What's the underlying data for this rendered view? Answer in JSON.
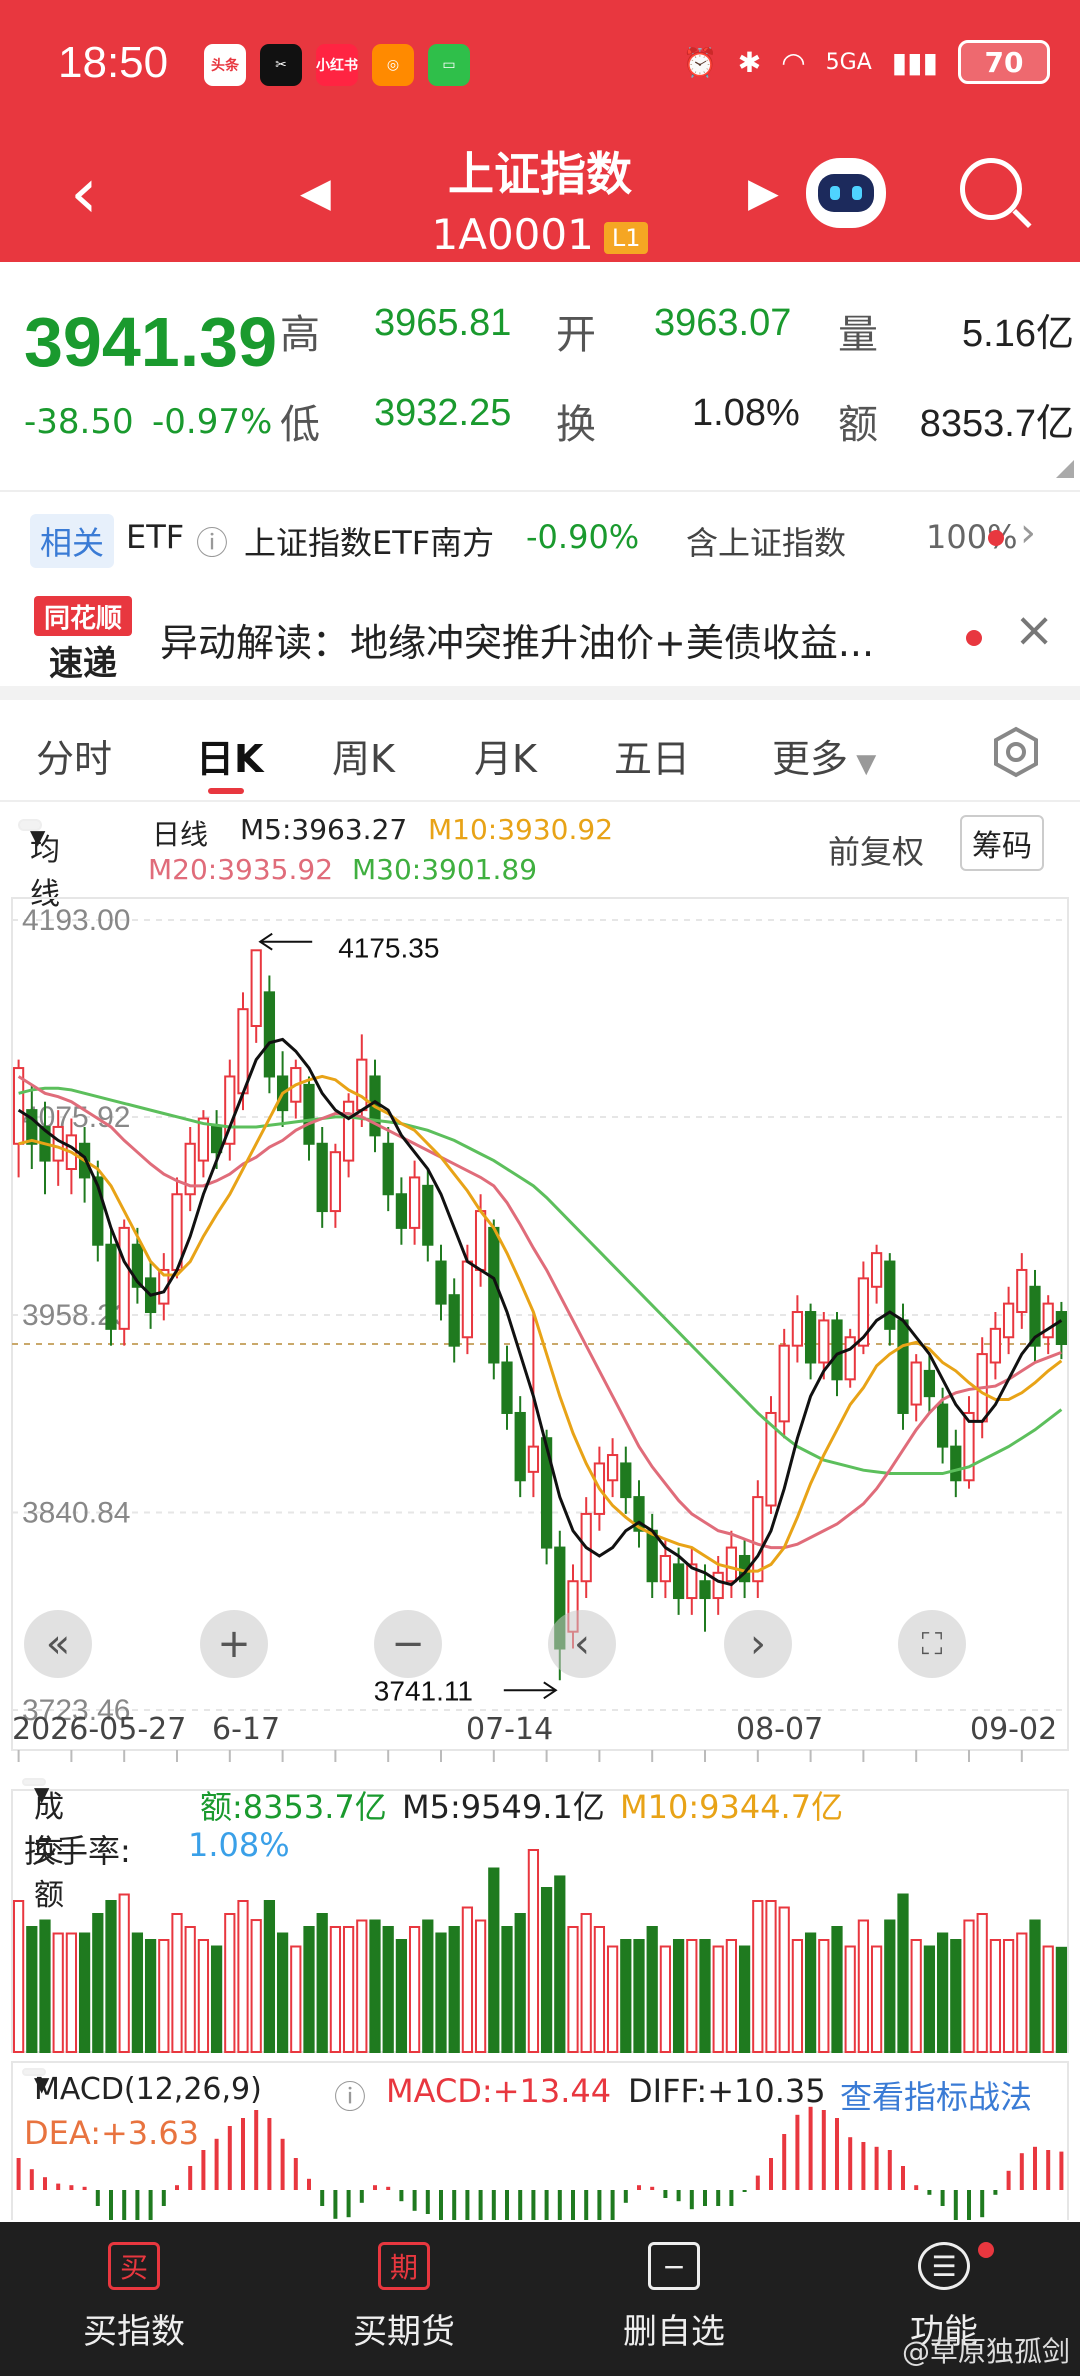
{
  "status": {
    "time": "18:50",
    "apps": [
      {
        "name": "头条",
        "color": "#e8373f"
      },
      {
        "name": "CapCut",
        "color": "#111111"
      },
      {
        "name": "小红书",
        "color": "#ff2442"
      },
      {
        "name": "app",
        "color": "#ff8a00"
      },
      {
        "name": "msg",
        "color": "#2fbf4a"
      }
    ],
    "network": "5GA",
    "battery": "70"
  },
  "nav": {
    "title": "上证指数",
    "code": "1A0001",
    "level": "L1"
  },
  "quote": {
    "price": "3941.39",
    "change": "-38.50",
    "change_pct": "-0.97%",
    "labels": {
      "high": "高",
      "open": "开",
      "volume": "量",
      "low": "低",
      "turnover": "换",
      "amount": "额"
    },
    "high": "3965.81",
    "open": "3963.07",
    "volume": "5.16亿",
    "low": "3932.25",
    "turnover": "1.08%",
    "amount": "8353.7亿"
  },
  "related": {
    "tag": "相关",
    "type": "ETF",
    "name": "上证指数ETF南方",
    "pct": "-0.90%",
    "contains": "含上证指数",
    "weight": "100%"
  },
  "news": {
    "logo_top": "同花顺",
    "logo_bottom": "速递",
    "text": "异动解读：地缘冲突推升油价+美债收益..."
  },
  "tabs": [
    {
      "label": "分时"
    },
    {
      "label": "日K"
    },
    {
      "label": "周K"
    },
    {
      "label": "月K"
    },
    {
      "label": "五日"
    },
    {
      "label": "更多"
    }
  ],
  "legend": {
    "selector": "均线",
    "period": "日线",
    "m5": "M5:3963.27",
    "m10": "M10:3930.92",
    "m20": "M20:3935.92",
    "m30": "M30:3901.89",
    "adjust": "前复权",
    "chips": "筹码"
  },
  "colors": {
    "up": "#e8373f",
    "down": "#1f7a1f",
    "m5": "#111111",
    "m10": "#e8a317",
    "m20": "#e06c7a",
    "m30": "#5cbf5c"
  },
  "chart_data": {
    "type": "candlestick",
    "y_ticks": [
      "4193.00",
      "4075.92",
      "3958.23",
      "3840.84",
      "3723.46"
    ],
    "ylim": [
      3723.46,
      4193.0
    ],
    "annotations": [
      {
        "label": "4175.35",
        "kind": "max"
      },
      {
        "label": "3741.11",
        "kind": "min"
      }
    ],
    "x_ticks": [
      "2026-05-27",
      "06-17",
      "07-14",
      "08-07",
      "09-02"
    ],
    "candles": [
      [
        4060,
        4105,
        4040,
        4110
      ],
      [
        4080,
        4060,
        4045,
        4095
      ],
      [
        4070,
        4050,
        4030,
        4085
      ],
      [
        4050,
        4070,
        4035,
        4080
      ],
      [
        4045,
        4065,
        4030,
        4075
      ],
      [
        4060,
        4040,
        4025,
        4070
      ],
      [
        4040,
        4000,
        3990,
        4050
      ],
      [
        4000,
        3950,
        3940,
        4010
      ],
      [
        3950,
        4010,
        3940,
        4015
      ],
      [
        4000,
        3975,
        3965,
        4010
      ],
      [
        3980,
        3960,
        3950,
        3990
      ],
      [
        3965,
        3985,
        3955,
        3995
      ],
      [
        3985,
        4030,
        3980,
        4040
      ],
      [
        4030,
        4060,
        4020,
        4070
      ],
      [
        4050,
        4075,
        4040,
        4080
      ],
      [
        4070,
        4055,
        4045,
        4080
      ],
      [
        4060,
        4100,
        4050,
        4110
      ],
      [
        4090,
        4140,
        4080,
        4150
      ],
      [
        4130,
        4175,
        4120,
        4175.35
      ],
      [
        4150,
        4100,
        4090,
        4160
      ],
      [
        4100,
        4080,
        4070,
        4115
      ],
      [
        4085,
        4105,
        4075,
        4110
      ],
      [
        4095,
        4060,
        4050,
        4100
      ],
      [
        4060,
        4020,
        4010,
        4070
      ],
      [
        4020,
        4055,
        4010,
        4060
      ],
      [
        4050,
        4085,
        4040,
        4090
      ],
      [
        4080,
        4110,
        4070,
        4125
      ],
      [
        4100,
        4065,
        4055,
        4110
      ],
      [
        4060,
        4030,
        4020,
        4070
      ],
      [
        4030,
        4010,
        4000,
        4040
      ],
      [
        4010,
        4040,
        4000,
        4050
      ],
      [
        4035,
        4000,
        3990,
        4045
      ],
      [
        3990,
        3965,
        3955,
        4000
      ],
      [
        3970,
        3940,
        3930,
        3980
      ],
      [
        3945,
        3990,
        3935,
        4000
      ],
      [
        3985,
        4020,
        3975,
        4030
      ],
      [
        4010,
        3930,
        3920,
        4015
      ],
      [
        3930,
        3900,
        3890,
        3940
      ],
      [
        3900,
        3860,
        3850,
        3910
      ],
      [
        3865,
        3880,
        3850,
        3960
      ],
      [
        3885,
        3820,
        3810,
        3890
      ],
      [
        3820,
        3760,
        3741.11,
        3830
      ],
      [
        3770,
        3800,
        3760,
        3810
      ],
      [
        3800,
        3840,
        3790,
        3850
      ],
      [
        3840,
        3870,
        3830,
        3880
      ],
      [
        3860,
        3875,
        3850,
        3885
      ],
      [
        3870,
        3850,
        3840,
        3880
      ],
      [
        3850,
        3830,
        3820,
        3860
      ],
      [
        3830,
        3800,
        3790,
        3840
      ],
      [
        3800,
        3815,
        3790,
        3825
      ],
      [
        3810,
        3790,
        3780,
        3820
      ],
      [
        3790,
        3810,
        3780,
        3820
      ],
      [
        3800,
        3790,
        3770,
        3810
      ],
      [
        3790,
        3805,
        3780,
        3815
      ],
      [
        3800,
        3820,
        3790,
        3830
      ],
      [
        3815,
        3800,
        3790,
        3825
      ],
      [
        3800,
        3850,
        3790,
        3860
      ],
      [
        3845,
        3900,
        3840,
        3910
      ],
      [
        3895,
        3940,
        3885,
        3950
      ],
      [
        3940,
        3960,
        3930,
        3970
      ],
      [
        3960,
        3930,
        3920,
        3965
      ],
      [
        3930,
        3955,
        3920,
        3960
      ],
      [
        3955,
        3920,
        3910,
        3960
      ],
      [
        3920,
        3945,
        3915,
        3950
      ],
      [
        3940,
        3980,
        3935,
        3990
      ],
      [
        3975,
        3995,
        3965,
        4000
      ],
      [
        3990,
        3950,
        3940,
        3995
      ],
      [
        3955,
        3900,
        3890,
        3965
      ],
      [
        3905,
        3930,
        3895,
        3935
      ],
      [
        3925,
        3910,
        3900,
        3935
      ],
      [
        3905,
        3880,
        3870,
        3915
      ],
      [
        3880,
        3860,
        3850,
        3890
      ],
      [
        3860,
        3900,
        3855,
        3910
      ],
      [
        3895,
        3935,
        3885,
        3945
      ],
      [
        3930,
        3950,
        3920,
        3960
      ],
      [
        3945,
        3965,
        3935,
        3975
      ],
      [
        3960,
        3985,
        3950,
        3995
      ],
      [
        3975,
        3940,
        3930,
        3985
      ],
      [
        3945,
        3965,
        3935,
        3970
      ],
      [
        3960,
        3941,
        3932,
        3966
      ]
    ],
    "ma": {
      "m5": [
        4080,
        4075,
        4068,
        4062,
        4058,
        4052,
        4035,
        4010,
        3990,
        3978,
        3970,
        3972,
        3985,
        4005,
        4030,
        4050,
        4070,
        4090,
        4110,
        4120,
        4122,
        4115,
        4105,
        4090,
        4080,
        4075,
        4080,
        4085,
        4080,
        4065,
        4055,
        4045,
        4030,
        4010,
        3990,
        3985,
        3980,
        3960,
        3935,
        3910,
        3880,
        3850,
        3830,
        3820,
        3815,
        3820,
        3830,
        3835,
        3830,
        3820,
        3815,
        3808,
        3805,
        3800,
        3798,
        3805,
        3815,
        3830,
        3855,
        3885,
        3910,
        3925,
        3935,
        3938,
        3945,
        3955,
        3960,
        3955,
        3945,
        3935,
        3920,
        3905,
        3895,
        3895,
        3905,
        3920,
        3935,
        3945,
        3950,
        3955
      ],
      "m10": [
        4060,
        4062,
        4060,
        4058,
        4055,
        4050,
        4045,
        4035,
        4020,
        4005,
        3990,
        3982,
        3982,
        3990,
        4005,
        4018,
        4030,
        4045,
        4060,
        4075,
        4090,
        4095,
        4098,
        4100,
        4098,
        4092,
        4088,
        4082,
        4078,
        4072,
        4068,
        4060,
        4052,
        4042,
        4032,
        4020,
        4010,
        3995,
        3978,
        3960,
        3935,
        3910,
        3888,
        3870,
        3855,
        3845,
        3838,
        3832,
        3828,
        3825,
        3822,
        3820,
        3815,
        3810,
        3808,
        3806,
        3806,
        3810,
        3820,
        3838,
        3858,
        3875,
        3890,
        3905,
        3915,
        3928,
        3935,
        3940,
        3942,
        3938,
        3930,
        3925,
        3918,
        3912,
        3908,
        3908,
        3912,
        3918,
        3925,
        3931
      ],
      "m20": [
        4100,
        4095,
        4090,
        4088,
        4085,
        4080,
        4075,
        4070,
        4062,
        4055,
        4048,
        4042,
        4038,
        4035,
        4035,
        4038,
        4042,
        4048,
        4052,
        4058,
        4062,
        4068,
        4072,
        4075,
        4078,
        4078,
        4076,
        4072,
        4068,
        4064,
        4060,
        4056,
        4052,
        4048,
        4044,
        4040,
        4035,
        4025,
        4012,
        3998,
        3985,
        3970,
        3955,
        3940,
        3925,
        3910,
        3895,
        3880,
        3868,
        3858,
        3848,
        3840,
        3835,
        3830,
        3828,
        3825,
        3822,
        3820,
        3820,
        3822,
        3826,
        3830,
        3834,
        3840,
        3846,
        3855,
        3866,
        3878,
        3890,
        3900,
        3908,
        3912,
        3914,
        3915,
        3916,
        3920,
        3925,
        3930,
        3933,
        3936
      ],
      "m30": [
        4090,
        4092,
        4093,
        4093,
        4092,
        4090,
        4088,
        4086,
        4084,
        4082,
        4080,
        4078,
        4076,
        4074,
        4072,
        4071,
        4070,
        4070,
        4070,
        4071,
        4072,
        4073,
        4074,
        4075,
        4076,
        4076,
        4075,
        4074,
        4073,
        4072,
        4070,
        4068,
        4065,
        4062,
        4058,
        4054,
        4050,
        4045,
        4040,
        4035,
        4028,
        4020,
        4012,
        4004,
        3996,
        3988,
        3980,
        3972,
        3964,
        3956,
        3948,
        3940,
        3932,
        3924,
        3916,
        3908,
        3900,
        3893,
        3886,
        3880,
        3876,
        3872,
        3870,
        3868,
        3866,
        3865,
        3864,
        3864,
        3864,
        3864,
        3864,
        3866,
        3868,
        3872,
        3876,
        3880,
        3885,
        3890,
        3896,
        3902
      ]
    }
  },
  "x_ticks": {
    "t0": "2026-05-27",
    "t1": "6-17",
    "t2": "07-14",
    "t3": "08-07",
    "t4": "09-02"
  },
  "volume": {
    "selector": "成交额",
    "amount": "额:8353.7亿",
    "m5": "M5:9549.1亿",
    "m10": "M10:9344.7亿",
    "turnover_label": "换手率:",
    "turnover": "1.08%"
  },
  "macd": {
    "selector": "MACD(12,26,9)",
    "macd": "MACD:+13.44",
    "diff": "DIFF:+10.35",
    "strategy": "查看指标战法",
    "dea": "DEA:+3.63"
  },
  "bottom": [
    {
      "icon": "买",
      "label": "买指数"
    },
    {
      "icon": "期",
      "label": "买期货"
    },
    {
      "icon": "−",
      "label": "删自选"
    },
    {
      "icon": "☰",
      "label": "功能"
    }
  ],
  "watermark": "@草原独孤剑"
}
